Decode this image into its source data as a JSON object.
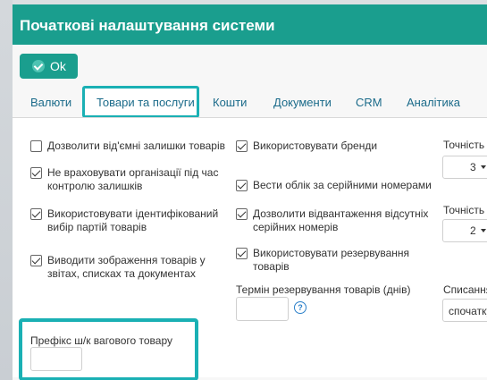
{
  "dialog": {
    "title": "Початкові налаштування системи",
    "ok_label": "Ok"
  },
  "tabs": [
    {
      "label": "Валюти"
    },
    {
      "label": "Товари та послуги",
      "active": true
    },
    {
      "label": "Кошти"
    },
    {
      "label": "Документи"
    },
    {
      "label": "CRM"
    },
    {
      "label": "Аналітика"
    }
  ],
  "col1": {
    "c1": {
      "line1": "Дозволити від'ємні залишки товарів",
      "checked": false
    },
    "c2": {
      "line1": "Не враховувати організації під час",
      "line2": "контролю залишків",
      "checked": true
    },
    "c3": {
      "line1": "Використовувати ідентифікований",
      "line2": "вибір партій товарів",
      "checked": true
    },
    "c4": {
      "line1": "Виводити зображення товарів у",
      "line2": "звітах, списках та документах",
      "checked": true
    },
    "prefix_label": "Префікс ш/к вагового товару",
    "prefix_value": ""
  },
  "col2": {
    "c1": {
      "line1": "Використовувати бренди",
      "checked": true
    },
    "c2": {
      "line1": "Вести облік за серійними номерами",
      "checked": true
    },
    "c3": {
      "line1": "Дозволити відвантаження відсутніх",
      "line2": "серійних номерів",
      "checked": true
    },
    "c4": {
      "line1": "Використовувати резервування",
      "line2": "товарів",
      "checked": true
    },
    "reserve_label": "Термін резервування товарів (днів)",
    "reserve_value": "",
    "help_glyph": "?"
  },
  "col3": {
    "label1": "Точність",
    "select1": "3",
    "label2": "Точність",
    "select2": "2",
    "label3": "Списання",
    "select3": "спочатку"
  },
  "colors": {
    "accent": "#1a9e8e",
    "highlight": "#1ab0b4",
    "link": "#1b6b8a"
  }
}
